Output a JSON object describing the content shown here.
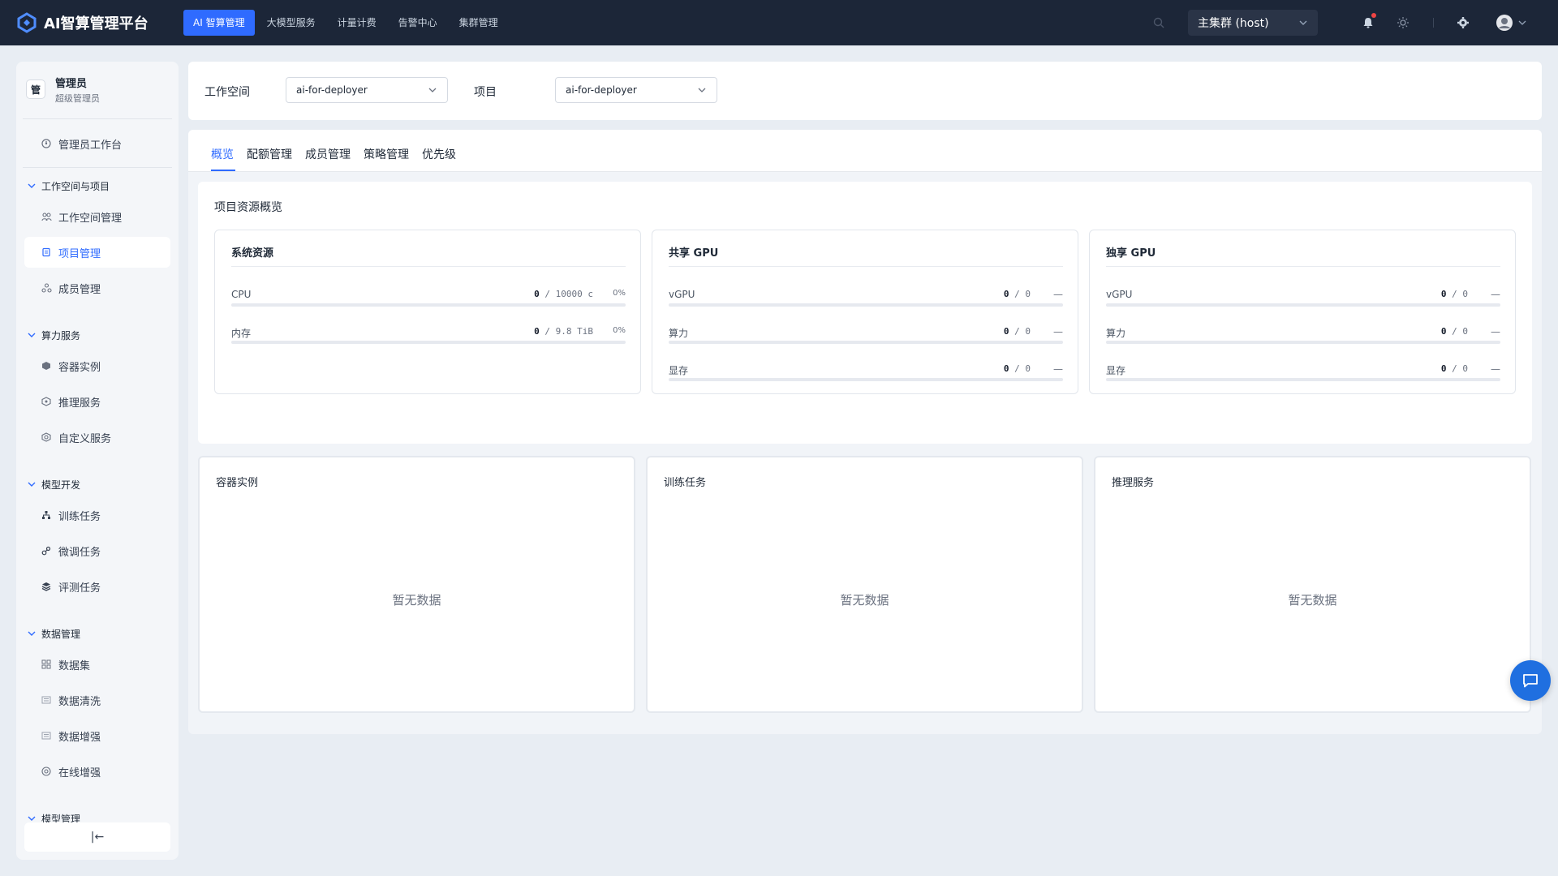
{
  "app": {
    "name": "AI智算管理平台"
  },
  "topnav": [
    {
      "label": "AI 智算管理",
      "active": true
    },
    {
      "label": "大模型服务"
    },
    {
      "label": "计量计费"
    },
    {
      "label": "告警中心"
    },
    {
      "label": "集群管理"
    }
  ],
  "cluster": {
    "label": "主集群 (host)"
  },
  "user": {
    "avatar": "管",
    "name": "管理员",
    "role": "超级管理员"
  },
  "sidebar": {
    "dashboard": "管理员工作台",
    "groups": {
      "workspace": "工作空间与项目",
      "compute": "算力服务",
      "model_dev": "模型开发",
      "data": "数据管理",
      "model_mgmt": "模型管理"
    },
    "items": {
      "workspace_mgmt": "工作空间管理",
      "project_mgmt": "项目管理",
      "member_mgmt": "成员管理",
      "container": "容器实例",
      "inference": "推理服务",
      "custom": "自定义服务",
      "training": "训练任务",
      "finetune": "微调任务",
      "eval": "评测任务",
      "dataset": "数据集",
      "clean": "数据清洗",
      "augment": "数据增强",
      "online_aug": "在线增强"
    },
    "collapse": "|←"
  },
  "filters": {
    "workspace_label": "工作空间",
    "workspace_value": "ai-for-deployer",
    "project_label": "项目",
    "project_value": "ai-for-deployer"
  },
  "tabs": [
    {
      "label": "概览",
      "active": true
    },
    {
      "label": "配额管理"
    },
    {
      "label": "成员管理"
    },
    {
      "label": "策略管理"
    },
    {
      "label": "优先级"
    }
  ],
  "overview": {
    "title": "项目资源概览",
    "system": {
      "title": "系统资源",
      "rows": [
        {
          "label": "CPU",
          "used": "0",
          "total": "/ 10000 c",
          "pct": "0%",
          "fill": 0
        },
        {
          "label": "内存",
          "used": "0",
          "total": "/ 9.8 TiB",
          "pct": "0%",
          "fill": 0
        }
      ]
    },
    "shared_gpu": {
      "title": "共享 GPU",
      "rows": [
        {
          "label": "vGPU",
          "used": "0",
          "total": "/ 0",
          "pct": "—",
          "fill": 0
        },
        {
          "label": "算力",
          "used": "0",
          "total": "/ 0",
          "pct": "—",
          "fill": 0
        },
        {
          "label": "显存",
          "used": "0",
          "total": "/ 0",
          "pct": "—",
          "fill": 0
        }
      ]
    },
    "exclusive_gpu": {
      "title": "独享 GPU",
      "rows": [
        {
          "label": "vGPU",
          "used": "0",
          "total": "/ 0",
          "pct": "—",
          "fill": 0
        },
        {
          "label": "算力",
          "used": "0",
          "total": "/ 0",
          "pct": "—",
          "fill": 0
        },
        {
          "label": "显存",
          "used": "0",
          "total": "/ 0",
          "pct": "—",
          "fill": 0
        }
      ]
    }
  },
  "panels": {
    "container": {
      "title": "容器实例",
      "empty": "暂无数据"
    },
    "training": {
      "title": "训练任务",
      "empty": "暂无数据"
    },
    "inference": {
      "title": "推理服务",
      "empty": "暂无数据"
    }
  },
  "colors": {
    "topbar": "#1c2638",
    "accent": "#2f6bff",
    "page_bg": "#e8edf3",
    "fab": "#1f6fe0"
  }
}
